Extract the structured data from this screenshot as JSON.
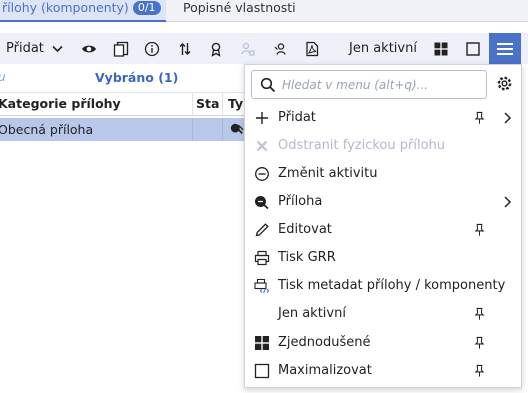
{
  "tabs": [
    {
      "label": "řílohy (komponenty)",
      "badge": "0/1"
    },
    {
      "label": "Popisné vlastnosti"
    }
  ],
  "toolbar": {
    "add_label": "Přidat",
    "only_active_label": "Jen aktivní"
  },
  "filter": {
    "partial_text": "u",
    "selected_label": "Vybráno (1)"
  },
  "grid": {
    "columns": [
      "Kategorie přílohy",
      "Sta",
      "Ty"
    ],
    "rows": [
      {
        "category": "Obecná příloha",
        "status": "",
        "type": ""
      }
    ]
  },
  "menu": {
    "search_placeholder": "Hledat v menu (alt+q)...",
    "items": [
      {
        "label": "Přidat",
        "icon": "plus-icon",
        "enabled": true,
        "pin": true,
        "submenu": true
      },
      {
        "label": "Odstranit fyzickou přílohu",
        "icon": "x-icon",
        "enabled": false,
        "pin": false,
        "submenu": false
      },
      {
        "label": "Změnit aktivitu",
        "icon": "minus-circle-icon",
        "enabled": true,
        "pin": false,
        "submenu": false
      },
      {
        "label": "Příloha",
        "icon": "attachment-icon",
        "enabled": true,
        "pin": false,
        "submenu": true
      },
      {
        "label": "Editovat",
        "icon": "pencil-icon",
        "enabled": true,
        "pin": true,
        "submenu": false
      },
      {
        "label": "Tisk GRR",
        "icon": "printer-icon",
        "enabled": true,
        "pin": false,
        "submenu": false
      },
      {
        "label": "Tisk metadat přílohy / komponenty",
        "icon": "printer-code-icon",
        "enabled": true,
        "pin": false,
        "submenu": false
      },
      {
        "label": "Jen aktivní",
        "icon": "",
        "enabled": true,
        "pin": true,
        "submenu": false
      },
      {
        "label": "Zjednodušené",
        "icon": "grid-icon",
        "enabled": true,
        "pin": true,
        "submenu": false
      },
      {
        "label": "Maximalizovat",
        "icon": "square-icon",
        "enabled": true,
        "pin": true,
        "submenu": false
      }
    ]
  },
  "colors": {
    "accent": "#4a72c9",
    "selected_row": "#b9c8ea",
    "toolbar_bg": "#eef1f9"
  }
}
